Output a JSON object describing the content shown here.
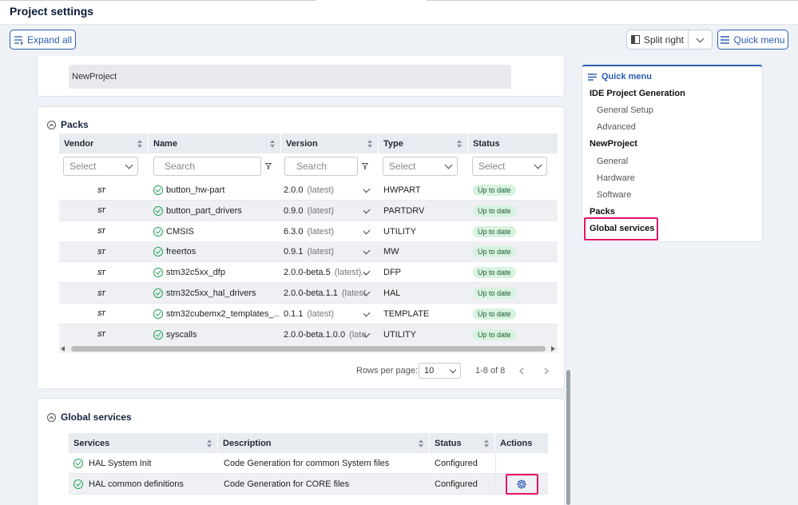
{
  "header": {
    "title": "Project settings"
  },
  "toolbar": {
    "expand_all": "Expand all",
    "split_right": "Split right",
    "quick_menu": "Quick menu"
  },
  "project": {
    "name": "NewProject"
  },
  "packs": {
    "title": "Packs",
    "columns": [
      "Vendor",
      "Name",
      "Version",
      "Type",
      "Status"
    ],
    "filters": {
      "vendor": "Select",
      "name": "Search",
      "version": "Search",
      "type": "Select",
      "status": "Select"
    },
    "rows": [
      {
        "vendor": "ST",
        "name": "button_hw-part",
        "version": "2.0.0",
        "latest": "(latest)",
        "type": "HWPART",
        "status": "Up to date"
      },
      {
        "vendor": "ST",
        "name": "button_part_drivers",
        "version": "0.9.0",
        "latest": "(latest)",
        "type": "PARTDRV",
        "status": "Up to date"
      },
      {
        "vendor": "ST",
        "name": "CMSIS",
        "version": "6.3.0",
        "latest": "(latest)",
        "type": "UTILITY",
        "status": "Up to date"
      },
      {
        "vendor": "ST",
        "name": "freertos",
        "version": "0.9.1",
        "latest": "(latest)",
        "type": "MW",
        "status": "Up to date"
      },
      {
        "vendor": "ST",
        "name": "stm32c5xx_dfp",
        "version": "2.0.0-beta.5",
        "latest": "(latest)...",
        "type": "DFP",
        "status": "Up to date"
      },
      {
        "vendor": "ST",
        "name": "stm32c5xx_hal_drivers",
        "version": "2.0.0-beta.1.1",
        "latest": "(latest)...",
        "type": "HAL",
        "status": "Up to date"
      },
      {
        "vendor": "ST",
        "name": "stm32cubemx2_templates_...",
        "version": "0.1.1",
        "latest": "(latest)",
        "type": "TEMPLATE",
        "status": "Up to date"
      },
      {
        "vendor": "ST",
        "name": "syscalls",
        "version": "2.0.0-beta.1.0.0",
        "latest": "(latest)...",
        "type": "UTILITY",
        "status": "Up to date"
      }
    ],
    "pagination": {
      "rows_per_page_label": "Rows per page:",
      "rows_per_page": "10",
      "range": "1-8 of 8"
    }
  },
  "global_services": {
    "title": "Global services",
    "columns": [
      "Services",
      "Description",
      "Status",
      "Actions"
    ],
    "rows": [
      {
        "service": "HAL System Init",
        "description": "Code Generation for common System files",
        "status": "Configured"
      },
      {
        "service": "HAL common definitions",
        "description": "Code Generation for CORE files",
        "status": "Configured"
      }
    ]
  },
  "quick_menu": {
    "title": "Quick menu",
    "items": [
      {
        "label": "IDE Project Generation",
        "level": 0
      },
      {
        "label": "General Setup",
        "level": 1
      },
      {
        "label": "Advanced",
        "level": 1
      },
      {
        "label": "NewProject",
        "level": 0
      },
      {
        "label": "General",
        "level": 1
      },
      {
        "label": "Hardware",
        "level": 1
      },
      {
        "label": "Software",
        "level": 1
      },
      {
        "label": "Packs",
        "level": 0
      },
      {
        "label": "Global services",
        "level": 0
      }
    ]
  },
  "colors": {
    "accent": "#2a5db0",
    "highlight": "#e8136b",
    "success": "#22a35a"
  }
}
